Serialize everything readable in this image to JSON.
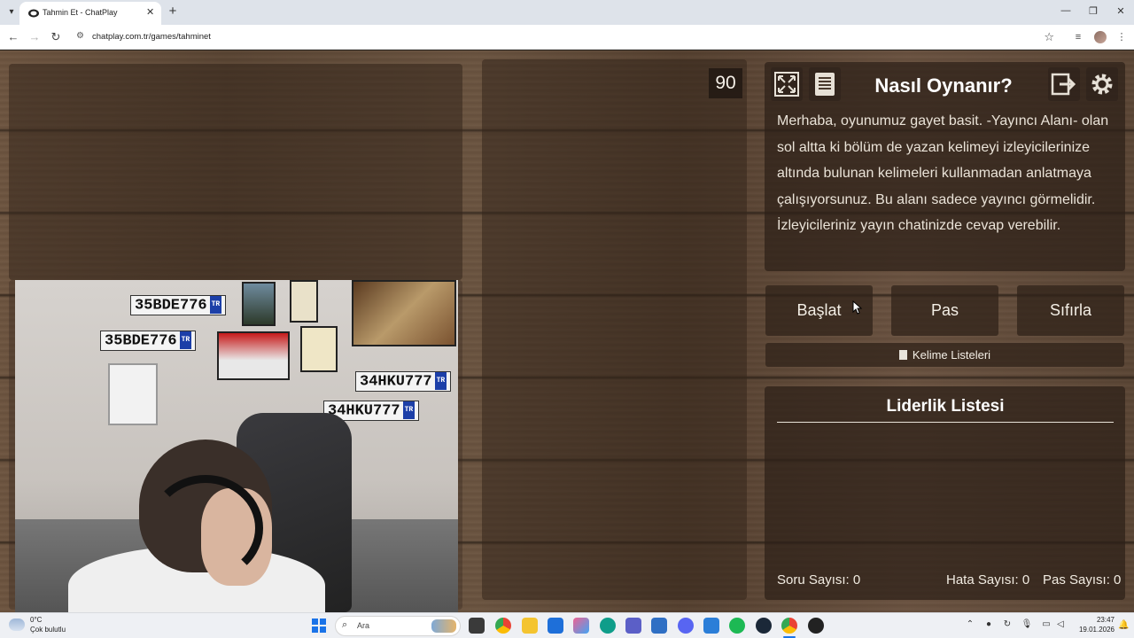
{
  "browser": {
    "tab_title": "Tahmin Et - ChatPlay",
    "url": "chatplay.com.tr/games/tahminet",
    "new_tab": "+",
    "close_tab": "✕"
  },
  "game": {
    "timer": "90",
    "how_title": "Nasıl Oynanır?",
    "how_text": "Merhaba, oyunumuz gayet basit. -Yayıncı Alanı- olan sol altta ki bölüm de yazan kelimeyi izleyicilerinize altında bulunan kelimeleri kullanmadan anlatmaya çalışıyorsunuz. Bu alanı sadece yayıncı görmelidir. İzleyicileriniz yayın chatinizde cevap verebilir.",
    "buttons": {
      "start": "Başlat",
      "pass": "Pas",
      "reset": "Sıfırla",
      "word_lists": "Kelime Listeleri"
    },
    "leaderboard_title": "Liderlik Listesi",
    "stats": {
      "questions": "Soru Sayısı: 0",
      "errors": "Hata Sayısı: 0",
      "passes": "Pas Sayısı: 0"
    }
  },
  "webcam": {
    "plates": [
      "35BDE776",
      "35BDE776",
      "34HKU777",
      "34HKU777"
    ],
    "plate_country": "TR"
  },
  "taskbar": {
    "weather_temp": "0°C",
    "weather_desc": "Çok bulutlu",
    "search_placeholder": "Ara",
    "time": "23:47",
    "date": "19.01.2026"
  },
  "colors": {
    "wood_dark": "#55402f",
    "panel": "#34261c",
    "text_light": "#eae3d8",
    "accent": "#1a73e8"
  }
}
